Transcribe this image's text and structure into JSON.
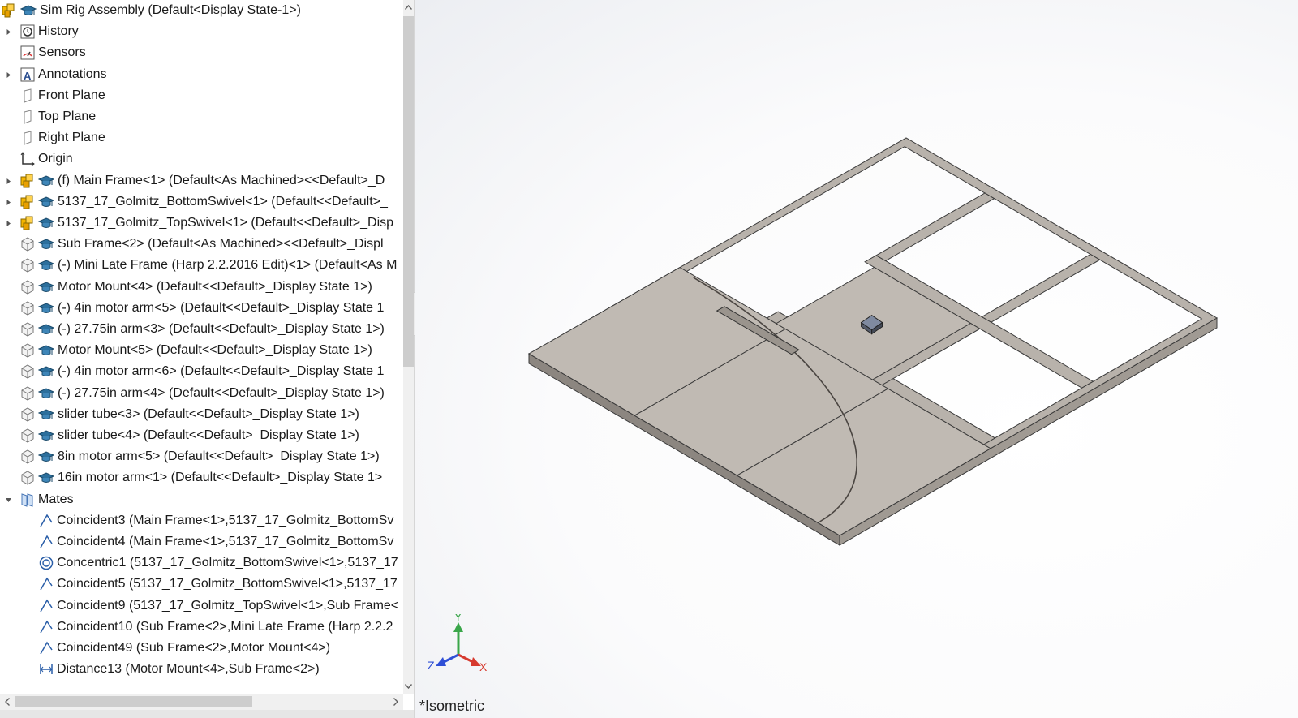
{
  "tree": {
    "items": [
      {
        "label": "Sim Rig Assembly  (Default<Display State-1>)",
        "icon": "assembly-icon",
        "level": 0,
        "expander": "none"
      },
      {
        "label": "History",
        "icon": "history-icon",
        "level": 1,
        "expander": "collapsed"
      },
      {
        "label": "Sensors",
        "icon": "sensors-icon",
        "level": 1,
        "expander": "none"
      },
      {
        "label": "Annotations",
        "icon": "annotations-icon",
        "level": 1,
        "expander": "collapsed"
      },
      {
        "label": "Front Plane",
        "icon": "plane-icon",
        "level": 1,
        "expander": "none"
      },
      {
        "label": "Top Plane",
        "icon": "plane-icon",
        "level": 1,
        "expander": "none"
      },
      {
        "label": "Right Plane",
        "icon": "plane-icon",
        "level": 1,
        "expander": "none"
      },
      {
        "label": "Origin",
        "icon": "origin-icon",
        "level": 1,
        "expander": "none"
      },
      {
        "label": "(f) Main Frame<1> (Default<As Machined><<Default>_D",
        "icon": "subassembly-icon",
        "level": 1,
        "expander": "collapsed"
      },
      {
        "label": "5137_17_Golmitz_BottomSwivel<1> (Default<<Default>_",
        "icon": "subassembly-icon",
        "level": 1,
        "expander": "collapsed"
      },
      {
        "label": "5137_17_Golmitz_TopSwivel<1> (Default<<Default>_Disp",
        "icon": "subassembly-icon",
        "level": 1,
        "expander": "collapsed"
      },
      {
        "label": "Sub Frame<2> (Default<As Machined><<Default>_Displ",
        "icon": "part-icon",
        "level": 1,
        "expander": "none"
      },
      {
        "label": "(-) Mini Late Frame (Harp 2.2.2016 Edit)<1> (Default<As M",
        "icon": "part-icon",
        "level": 1,
        "expander": "none"
      },
      {
        "label": "Motor Mount<4> (Default<<Default>_Display State 1>)",
        "icon": "part-icon",
        "level": 1,
        "expander": "none"
      },
      {
        "label": "(-) 4in motor arm<5> (Default<<Default>_Display State 1",
        "icon": "part-icon",
        "level": 1,
        "expander": "none"
      },
      {
        "label": "(-) 27.75in arm<3> (Default<<Default>_Display State 1>)",
        "icon": "part-icon",
        "level": 1,
        "expander": "none"
      },
      {
        "label": "Motor Mount<5> (Default<<Default>_Display State 1>)",
        "icon": "part-icon",
        "level": 1,
        "expander": "none"
      },
      {
        "label": "(-) 4in motor arm<6> (Default<<Default>_Display State 1",
        "icon": "part-icon",
        "level": 1,
        "expander": "none"
      },
      {
        "label": "(-) 27.75in arm<4> (Default<<Default>_Display State 1>)",
        "icon": "part-icon",
        "level": 1,
        "expander": "none"
      },
      {
        "label": "slider tube<3> (Default<<Default>_Display State 1>)",
        "icon": "part-icon",
        "level": 1,
        "expander": "none"
      },
      {
        "label": "slider tube<4> (Default<<Default>_Display State 1>)",
        "icon": "part-icon",
        "level": 1,
        "expander": "none"
      },
      {
        "label": "8in motor arm<5> (Default<<Default>_Display State 1>)",
        "icon": "part-icon",
        "level": 1,
        "expander": "none"
      },
      {
        "label": "16in motor arm<1> (Default<<Default>_Display State 1>",
        "icon": "part-icon",
        "level": 1,
        "expander": "none"
      },
      {
        "label": "Mates",
        "icon": "mates-icon",
        "level": 1,
        "expander": "expanded"
      },
      {
        "label": "Coincident3 (Main Frame<1>,5137_17_Golmitz_BottomSv",
        "icon": "coincident-mate-icon",
        "level": 2,
        "expander": "none"
      },
      {
        "label": "Coincident4 (Main Frame<1>,5137_17_Golmitz_BottomSv",
        "icon": "coincident-mate-icon",
        "level": 2,
        "expander": "none"
      },
      {
        "label": "Concentric1 (5137_17_Golmitz_BottomSwivel<1>,5137_17",
        "icon": "concentric-mate-icon",
        "level": 2,
        "expander": "none"
      },
      {
        "label": "Coincident5 (5137_17_Golmitz_BottomSwivel<1>,5137_17",
        "icon": "coincident-mate-icon",
        "level": 2,
        "expander": "none"
      },
      {
        "label": "Coincident9 (5137_17_Golmitz_TopSwivel<1>,Sub Frame<",
        "icon": "coincident-mate-icon",
        "level": 2,
        "expander": "none"
      },
      {
        "label": "Coincident10 (Sub Frame<2>,Mini Late Frame (Harp 2.2.2",
        "icon": "coincident-mate-icon",
        "level": 2,
        "expander": "none"
      },
      {
        "label": "Coincident49 (Sub Frame<2>,Motor Mount<4>)",
        "icon": "coincident-mate-icon",
        "level": 2,
        "expander": "none"
      },
      {
        "label": "Distance13 (Motor Mount<4>,Sub Frame<2>)",
        "icon": "distance-mate-icon",
        "level": 2,
        "expander": "none"
      }
    ]
  },
  "viewport": {
    "view_name": "*Isometric",
    "triad": {
      "y_label": "Y",
      "z_label": "Z",
      "x_label": "X"
    }
  },
  "colors": {
    "frame_top": "#b8b2ab",
    "frame_side": "#8c8680",
    "frame_edge": "#3a3a3a",
    "plate_fill": "#c0bab3",
    "axis_x": "#d63a2f",
    "axis_y": "#3aa64a",
    "axis_z": "#2f4fd6"
  }
}
